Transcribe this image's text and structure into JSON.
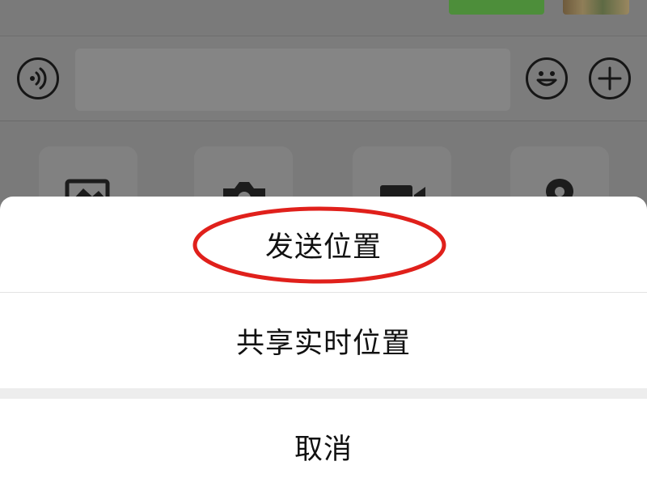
{
  "chat": {
    "input_placeholder": "",
    "bubble_color": "#4d8e3a"
  },
  "input_bar": {
    "voice_icon": "voice-icon",
    "emoji_icon": "emoji-icon",
    "plus_icon": "plus-icon"
  },
  "panel": {
    "tiles": [
      {
        "icon": "photo-icon"
      },
      {
        "icon": "camera-icon"
      },
      {
        "icon": "video-call-icon"
      },
      {
        "icon": "location-icon"
      }
    ]
  },
  "sheet": {
    "send_location": "发送位置",
    "share_live_location": "共享实时位置",
    "cancel": "取消"
  },
  "annotation": {
    "ring_color": "#e0201b"
  }
}
